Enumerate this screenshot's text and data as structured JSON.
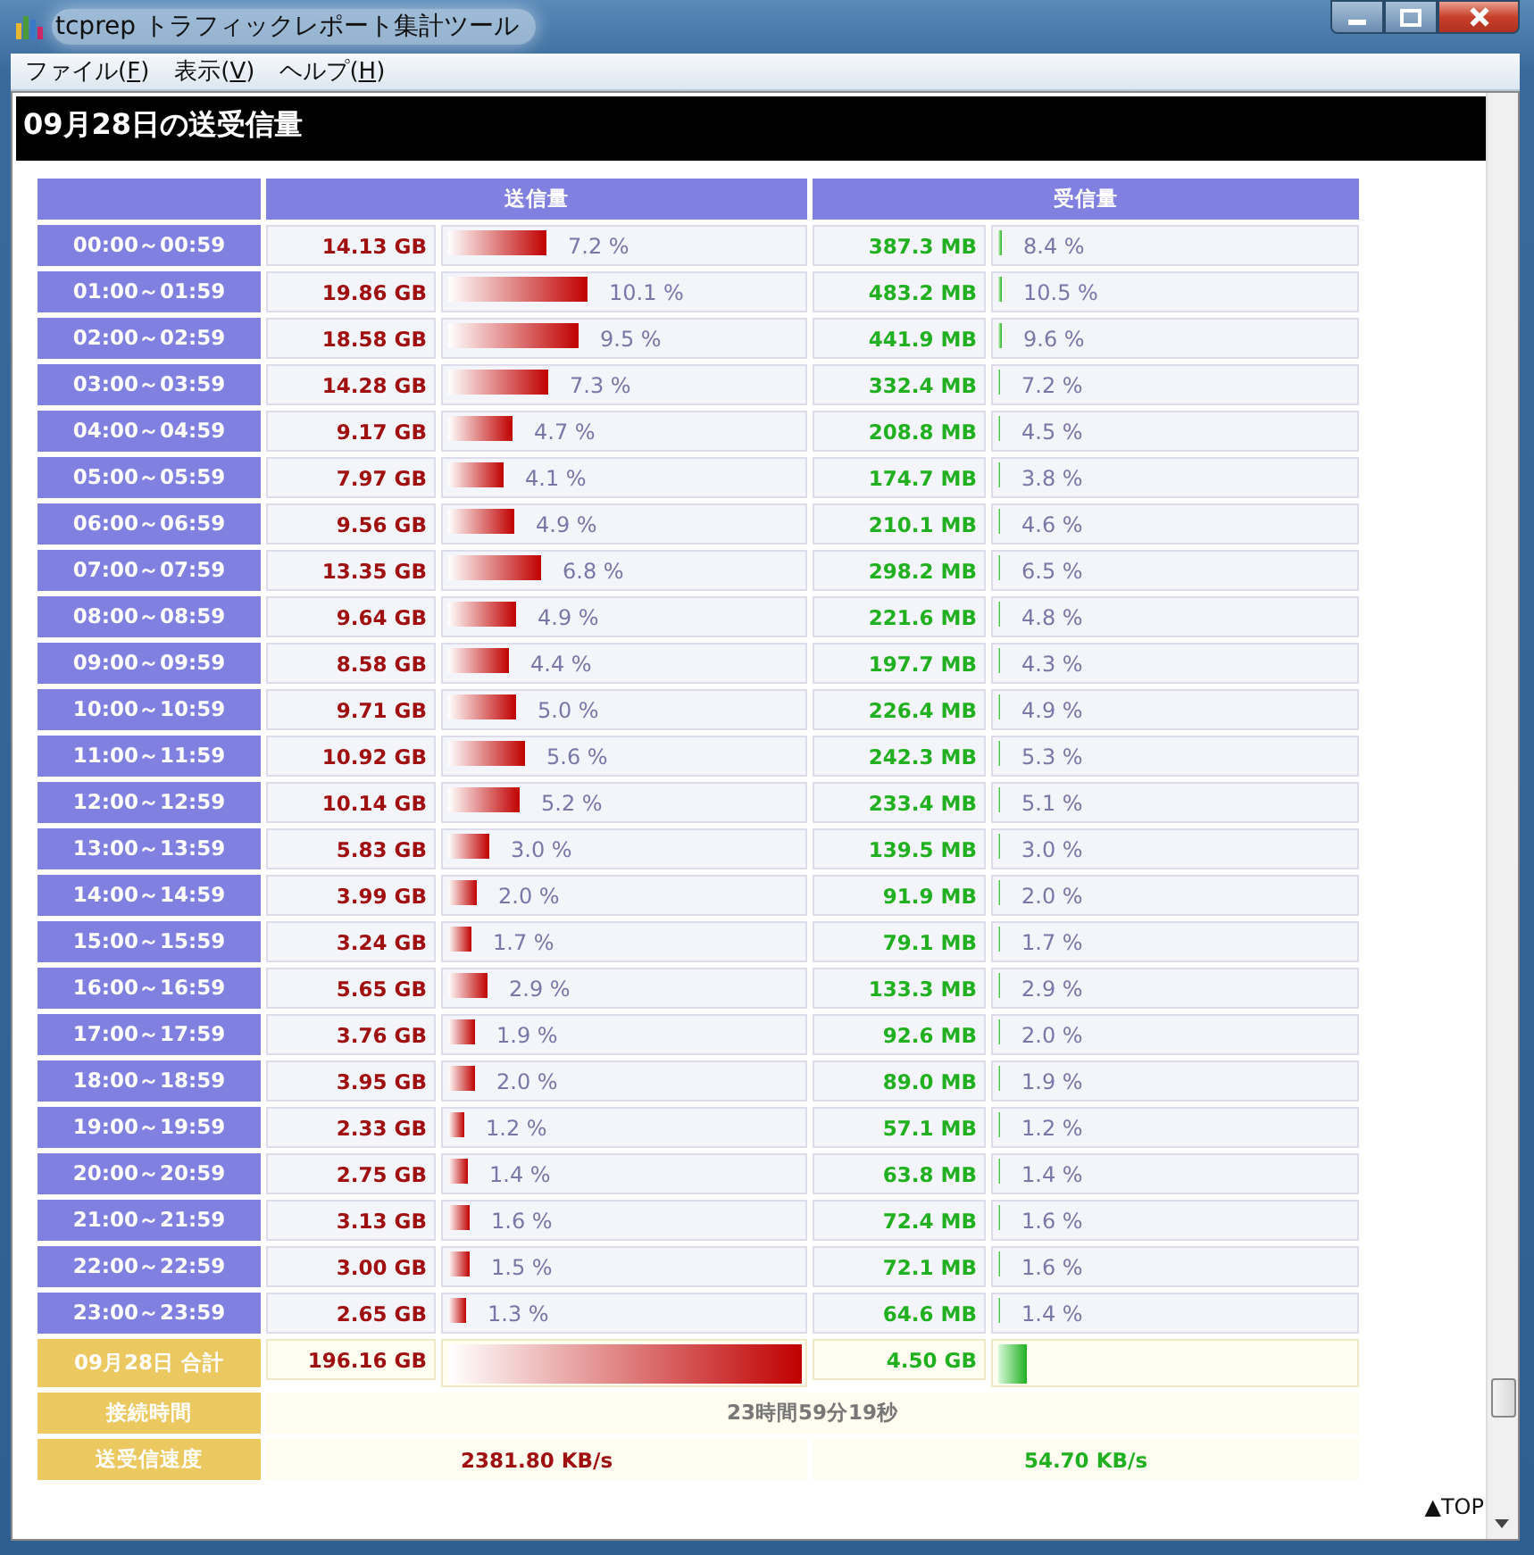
{
  "window": {
    "title": "tcprep トラフィックレポート集計ツール"
  },
  "menu": [
    {
      "before": "ファイル(",
      "key": "F",
      "after": ")"
    },
    {
      "before": "表示(",
      "key": "V",
      "after": ")"
    },
    {
      "before": "ヘルプ(",
      "key": "H",
      "after": ")"
    }
  ],
  "heading": "09月28日の送受信量",
  "columns": [
    "送信量",
    "受信量"
  ],
  "hours": [
    {
      "time": "00:00～00:59",
      "sent": {
        "value": "14.13 GB",
        "level": 0.277,
        "percent": "7.2 %"
      },
      "received": {
        "value": "387.3 MB",
        "level": 0.008,
        "percent": "8.4 %"
      }
    },
    {
      "time": "01:00～01:59",
      "sent": {
        "value": "19.86 GB",
        "level": 0.389,
        "percent": "10.1 %"
      },
      "received": {
        "value": "483.2 MB",
        "level": 0.009,
        "percent": "10.5 %"
      }
    },
    {
      "time": "02:00～02:59",
      "sent": {
        "value": "18.58 GB",
        "level": 0.364,
        "percent": "9.5 %"
      },
      "received": {
        "value": "441.9 MB",
        "level": 0.009,
        "percent": "9.6 %"
      }
    },
    {
      "time": "03:00～03:59",
      "sent": {
        "value": "14.28 GB",
        "level": 0.28,
        "percent": "7.3 %"
      },
      "received": {
        "value": "332.4 MB",
        "level": 0.007,
        "percent": "7.2 %"
      }
    },
    {
      "time": "04:00～04:59",
      "sent": {
        "value": "9.17 GB",
        "level": 0.18,
        "percent": "4.7 %"
      },
      "received": {
        "value": "208.8 MB",
        "level": 0.004,
        "percent": "4.5 %"
      }
    },
    {
      "time": "05:00～05:59",
      "sent": {
        "value": "7.97 GB",
        "level": 0.156,
        "percent": "4.1 %"
      },
      "received": {
        "value": "174.7 MB",
        "level": 0.003,
        "percent": "3.8 %"
      }
    },
    {
      "time": "06:00～06:59",
      "sent": {
        "value": "9.56 GB",
        "level": 0.187,
        "percent": "4.9 %"
      },
      "received": {
        "value": "210.1 MB",
        "level": 0.004,
        "percent": "4.6 %"
      }
    },
    {
      "time": "07:00～07:59",
      "sent": {
        "value": "13.35 GB",
        "level": 0.262,
        "percent": "6.8 %"
      },
      "received": {
        "value": "298.2 MB",
        "level": 0.006,
        "percent": "6.5 %"
      }
    },
    {
      "time": "08:00～08:59",
      "sent": {
        "value": "9.64 GB",
        "level": 0.189,
        "percent": "4.9 %"
      },
      "received": {
        "value": "221.6 MB",
        "level": 0.004,
        "percent": "4.8 %"
      }
    },
    {
      "time": "09:00～09:59",
      "sent": {
        "value": "8.58 GB",
        "level": 0.168,
        "percent": "4.4 %"
      },
      "received": {
        "value": "197.7 MB",
        "level": 0.004,
        "percent": "4.3 %"
      }
    },
    {
      "time": "10:00～10:59",
      "sent": {
        "value": "9.71 GB",
        "level": 0.19,
        "percent": "5.0 %"
      },
      "received": {
        "value": "226.4 MB",
        "level": 0.004,
        "percent": "4.9 %"
      }
    },
    {
      "time": "11:00～11:59",
      "sent": {
        "value": "10.92 GB",
        "level": 0.214,
        "percent": "5.6 %"
      },
      "received": {
        "value": "242.3 MB",
        "level": 0.005,
        "percent": "5.3 %"
      }
    },
    {
      "time": "12:00～12:59",
      "sent": {
        "value": "10.14 GB",
        "level": 0.199,
        "percent": "5.2 %"
      },
      "received": {
        "value": "233.4 MB",
        "level": 0.005,
        "percent": "5.1 %"
      }
    },
    {
      "time": "13:00～13:59",
      "sent": {
        "value": "5.83 GB",
        "level": 0.114,
        "percent": "3.0 %"
      },
      "received": {
        "value": "139.5 MB",
        "level": 0.003,
        "percent": "3.0 %"
      }
    },
    {
      "time": "14:00～14:59",
      "sent": {
        "value": "3.99 GB",
        "level": 0.078,
        "percent": "2.0 %"
      },
      "received": {
        "value": "91.9 MB",
        "level": 0.002,
        "percent": "2.0 %"
      }
    },
    {
      "time": "15:00～15:59",
      "sent": {
        "value": "3.24 GB",
        "level": 0.064,
        "percent": "1.7 %"
      },
      "received": {
        "value": "79.1 MB",
        "level": 0.002,
        "percent": "1.7 %"
      }
    },
    {
      "time": "16:00～16:59",
      "sent": {
        "value": "5.65 GB",
        "level": 0.111,
        "percent": "2.9 %"
      },
      "received": {
        "value": "133.3 MB",
        "level": 0.003,
        "percent": "2.9 %"
      }
    },
    {
      "time": "17:00～17:59",
      "sent": {
        "value": "3.76 GB",
        "level": 0.074,
        "percent": "1.9 %"
      },
      "received": {
        "value": "92.6 MB",
        "level": 0.002,
        "percent": "2.0 %"
      }
    },
    {
      "time": "18:00～18:59",
      "sent": {
        "value": "3.95 GB",
        "level": 0.077,
        "percent": "2.0 %"
      },
      "received": {
        "value": "89.0 MB",
        "level": 0.002,
        "percent": "1.9 %"
      }
    },
    {
      "time": "19:00～19:59",
      "sent": {
        "value": "2.33 GB",
        "level": 0.046,
        "percent": "1.2 %"
      },
      "received": {
        "value": "57.1 MB",
        "level": 0.001,
        "percent": "1.2 %"
      }
    },
    {
      "time": "20:00～20:59",
      "sent": {
        "value": "2.75 GB",
        "level": 0.054,
        "percent": "1.4 %"
      },
      "received": {
        "value": "63.8 MB",
        "level": 0.001,
        "percent": "1.4 %"
      }
    },
    {
      "time": "21:00～21:59",
      "sent": {
        "value": "3.13 GB",
        "level": 0.061,
        "percent": "1.6 %"
      },
      "received": {
        "value": "72.4 MB",
        "level": 0.001,
        "percent": "1.6 %"
      }
    },
    {
      "time": "22:00～22:59",
      "sent": {
        "value": "3.00 GB",
        "level": 0.059,
        "percent": "1.5 %"
      },
      "received": {
        "value": "72.1 MB",
        "level": 0.001,
        "percent": "1.6 %"
      }
    },
    {
      "time": "23:00～23:59",
      "sent": {
        "value": "2.65 GB",
        "level": 0.052,
        "percent": "1.3 %"
      },
      "received": {
        "value": "64.6 MB",
        "level": 0.001,
        "percent": "1.4 %"
      }
    }
  ],
  "total": {
    "label": "09月28日 合計",
    "sent": {
      "value": "196.16 GB",
      "level": 1
    },
    "received": {
      "value": "4.50 GB",
      "level": 0.08
    }
  },
  "connection": {
    "label": "接続時間",
    "value": "23時間59分19秒"
  },
  "speed": {
    "label": "送受信速度",
    "sent": "2381.80 KB/s",
    "received": "54.70 KB/s"
  },
  "top_link": "▲TOP"
}
